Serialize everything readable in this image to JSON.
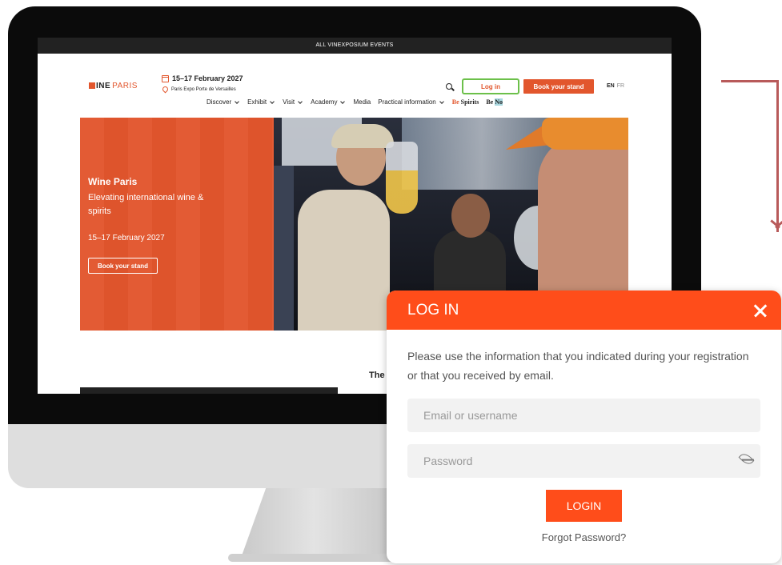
{
  "site": {
    "top_strip": "ALL VINEXPOSIUM EVENTS",
    "logo": {
      "main": "INE",
      "sub": "PARIS"
    },
    "event_date": "15–17 February 2027",
    "event_venue": "Paris Expo Porte de Versailles",
    "login_label": "Log in",
    "book_label": "Book your stand",
    "lang_en": "EN",
    "lang_fr": "FR",
    "nav": [
      {
        "label": "Discover"
      },
      {
        "label": "Exhibit"
      },
      {
        "label": "Visit"
      },
      {
        "label": "Academy"
      },
      {
        "label": "Media"
      },
      {
        "label": "Practical information"
      }
    ],
    "brand_bespirits": {
      "hi": "Be",
      "rest": "Spirits"
    },
    "brand_beno": {
      "hi": "Be",
      "rest": "No"
    }
  },
  "hero": {
    "title": "Wine Paris",
    "subtitle": "Elevating international wine & spirits",
    "date": "15–17 February 2027",
    "cta": "Book your stand"
  },
  "below": {
    "heading_fragment": "The"
  },
  "login_modal": {
    "title": "LOG IN",
    "message": "Please use the information that you indicated during your registration or that you received by email.",
    "email_placeholder": "Email or username",
    "password_placeholder": "Password",
    "submit_label": "LOGIN",
    "forgot_label": "Forgot Password?"
  },
  "colors": {
    "brand_orange": "#e2562d",
    "modal_orange": "#ff4d1a",
    "login_border": "#6cc04a",
    "arrow": "#b85a5a"
  }
}
